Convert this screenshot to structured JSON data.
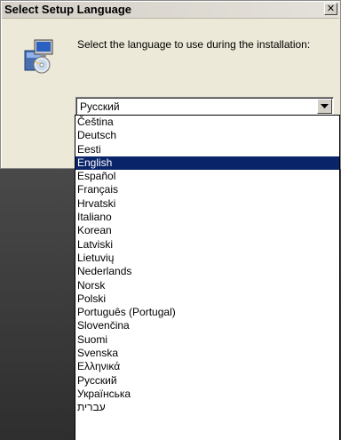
{
  "dialog": {
    "title": "Select Setup Language",
    "close_label": "✕",
    "prompt": "Select the language to use during the installation:",
    "combo": {
      "selected": "Русский"
    }
  },
  "dropdown": {
    "selected_index": 3,
    "options": [
      "Čeština",
      "Deutsch",
      "Eesti",
      "English",
      "Español",
      "Français",
      "Hrvatski",
      "Italiano",
      "Korean",
      "Latviski",
      "Lietuvių",
      "Nederlands",
      "Norsk",
      "Polski",
      "Português (Portugal)",
      "Slovenčina",
      "Suomi",
      "Svenska",
      "Ελληνικά",
      "Русский",
      "Українська",
      "עברית"
    ]
  },
  "icons": {
    "setup": "setup-computer-cd-icon",
    "dropdown": "chevron-down-icon",
    "close": "close-icon"
  }
}
